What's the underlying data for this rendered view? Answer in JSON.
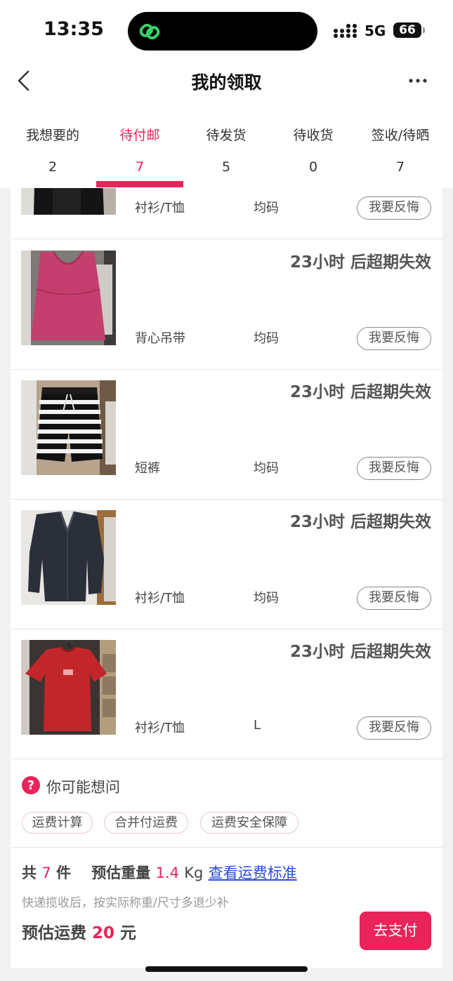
{
  "status_bar": {
    "time": "13:35",
    "network": "5G",
    "battery": "66"
  },
  "nav": {
    "title": "我的领取"
  },
  "tabs": [
    {
      "label": "我想要的",
      "count": "2"
    },
    {
      "label": "待付邮",
      "count": "7"
    },
    {
      "label": "待发货",
      "count": "5"
    },
    {
      "label": "待收货",
      "count": "0"
    },
    {
      "label": "签收/待晒",
      "count": "7"
    }
  ],
  "active_tab": "待付邮",
  "colors": {
    "accent": "#e8245a",
    "link": "#2a4bd8"
  },
  "items": [
    {
      "countdown": "",
      "category": "衬衫/T恤",
      "size": "均码",
      "action": "我要反悔",
      "image": "black-top-partial"
    },
    {
      "countdown": "23小时 后超期失效",
      "category": "背心吊带",
      "size": "均码",
      "action": "我要反悔",
      "image": "pink-tank-top"
    },
    {
      "countdown": "23小时 后超期失效",
      "category": "短裤",
      "size": "均码",
      "action": "我要反悔",
      "image": "striped-shorts"
    },
    {
      "countdown": "23小时 后超期失效",
      "category": "衬衫/T恤",
      "size": "均码",
      "action": "我要反悔",
      "image": "navy-shirt"
    },
    {
      "countdown": "23小时 后超期失效",
      "category": "衬衫/T恤",
      "size": "L",
      "action": "我要反悔",
      "image": "red-tshirt"
    }
  ],
  "faq": {
    "title": "你可能想问",
    "chips": [
      "运费计算",
      "合并付运费",
      "运费安全保障"
    ]
  },
  "summary": {
    "prefix": "共",
    "count": "7",
    "count_unit": "件",
    "weight_label": "预估重量",
    "weight": "1.4",
    "weight_unit": "Kg",
    "link": "查看运费标准",
    "note": "快递揽收后，按实际称重/尺寸多退少补",
    "fee_label": "预估运费",
    "fee": "20",
    "fee_unit": "元",
    "pay_label": "去支付"
  }
}
